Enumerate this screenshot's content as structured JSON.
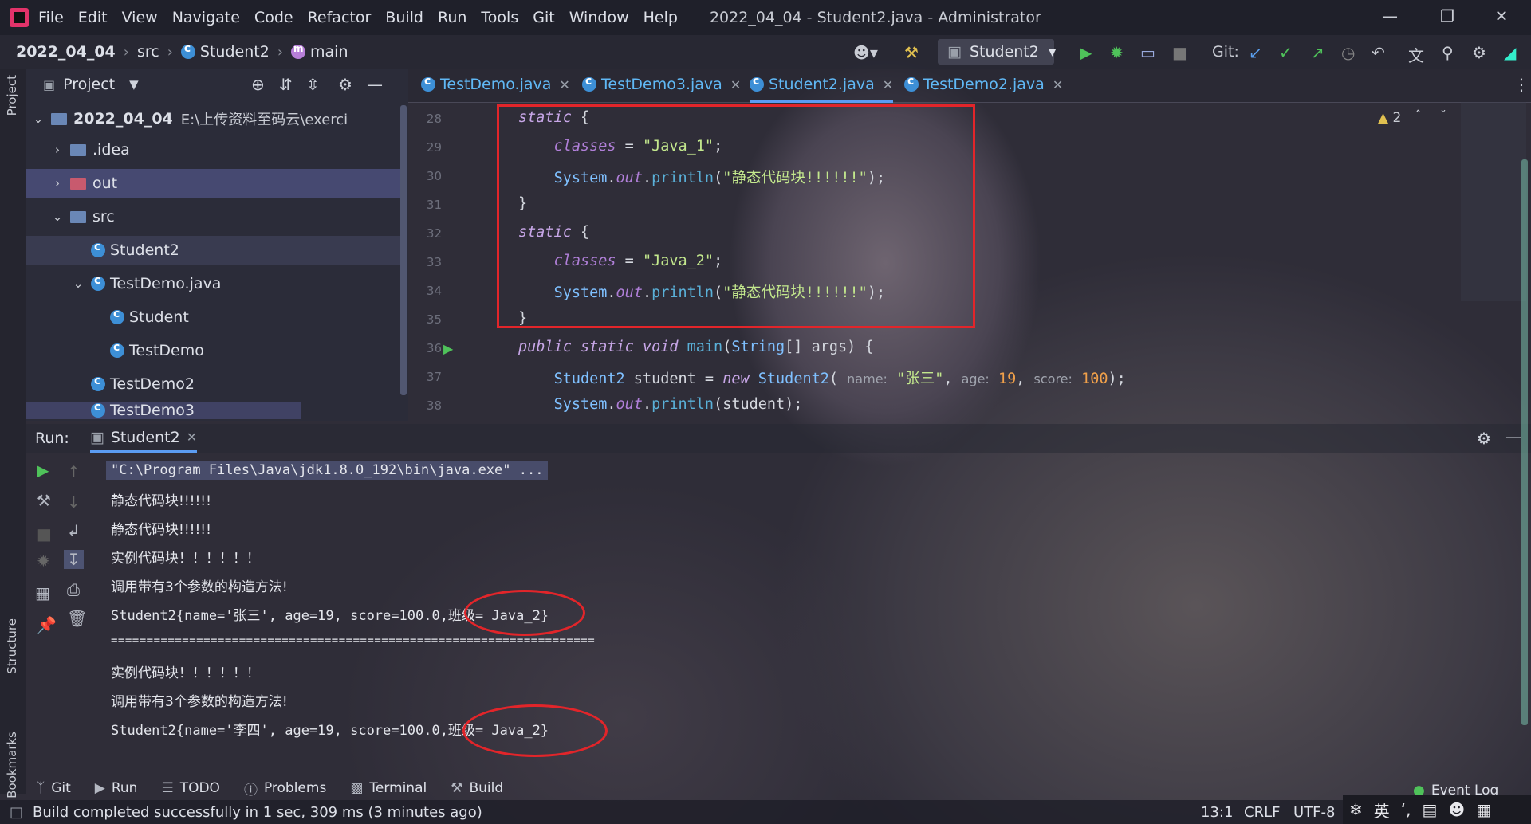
{
  "app": {
    "menu": [
      "File",
      "Edit",
      "View",
      "Navigate",
      "Code",
      "Refactor",
      "Build",
      "Run",
      "Tools",
      "Git",
      "Window",
      "Help"
    ],
    "window_title": "2022_04_04 - Student2.java - Administrator"
  },
  "breadcrumb": {
    "project": "2022_04_04",
    "folder": "src",
    "class": "Student2",
    "method": "main"
  },
  "toolbar": {
    "run_config": "Student2",
    "git_label": "Git:"
  },
  "project_panel": {
    "title": "Project",
    "root_name": "2022_04_04",
    "root_path": "E:\\上传资料至码云\\exercise---java-cc",
    "items": [
      ".idea",
      "out",
      "src",
      "Student2",
      "TestDemo.java",
      "Student",
      "TestDemo",
      "TestDemo2",
      "TestDemo3"
    ]
  },
  "tabs": [
    "TestDemo.java",
    "TestDemo3.java",
    "Student2.java",
    "TestDemo2.java"
  ],
  "editor": {
    "line_numbers": [
      "28",
      "29",
      "30",
      "31",
      "32",
      "33",
      "34",
      "35",
      "36",
      "37",
      "38"
    ],
    "warnings": "2",
    "hint_name": "name:",
    "hint_age": "age:",
    "hint_score": "score:",
    "str_java1": "\"Java_1\"",
    "str_java2": "\"Java_2\"",
    "str_static": "\"静态代码块!!!!!!\"",
    "str_zhangsan": "\"张三\"",
    "num_age": "19",
    "num_score": "100"
  },
  "run_panel": {
    "label": "Run:",
    "tab": "Student2",
    "lines": [
      "\"C:\\Program Files\\Java\\jdk1.8.0_192\\bin\\java.exe\" ...",
      "静态代码块!!!!!!",
      "静态代码块!!!!!!",
      "实例代码块！！！！！！",
      "调用带有3个参数的构造方法!",
      "Student2{name='张三', age=19, score=100.0,班级= Java_2}",
      "====================================================================",
      "实例代码块！！！！！！",
      "调用带有3个参数的构造方法!",
      "Student2{name='李四', age=19, score=100.0,班级= Java_2}"
    ]
  },
  "side_labels": {
    "project": "Project",
    "structure": "Structure",
    "bookmarks": "Bookmarks"
  },
  "bottom_tabs": [
    "Git",
    "Run",
    "TODO",
    "Problems",
    "Terminal",
    "Build"
  ],
  "event_log": "Event Log",
  "status": {
    "message": "Build completed successfully in 1 sec, 309 ms (3 minutes ago)",
    "position": "13:1",
    "line_sep": "CRLF",
    "encoding": "UTF-8",
    "ime": "英"
  }
}
